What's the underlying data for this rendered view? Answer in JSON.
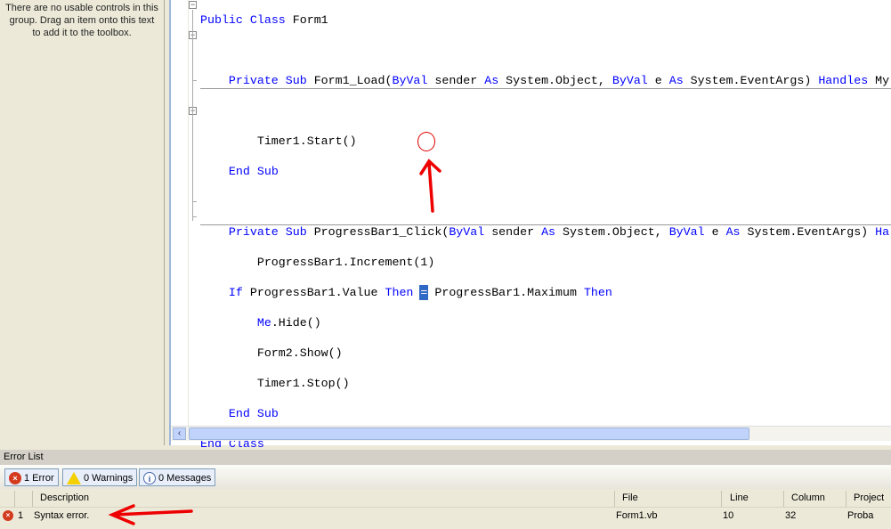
{
  "toolbox": {
    "empty_text": "There are no usable controls in this group. Drag an item onto this text to add it to the toolbox."
  },
  "code": {
    "l1": [
      "Public",
      " ",
      "Class",
      " Form1"
    ],
    "l3": {
      "a": "Private",
      "b": "Sub",
      "c": " Form1_Load(",
      "d": "ByVal",
      "e": " sender ",
      "f": "As",
      "g": " System.Object, ",
      "h": "ByVal",
      "i": " e ",
      "j": "As",
      "k": " System.EventArgs) ",
      "l": "Handles",
      "m": " My"
    },
    "l5": "Timer1.Start()",
    "l6": [
      "End",
      "Sub"
    ],
    "l8": {
      "a": "Private",
      "b": "Sub",
      "c": " ProgressBar1_Click(",
      "d": "ByVal",
      "e": " sender ",
      "f": "As",
      "g": " System.Object, ",
      "h": "ByVal",
      "i": " e ",
      "j": "As",
      "k": " System.EventArgs) ",
      "l": "Ha"
    },
    "l9": "ProgressBar1.Increment(1)",
    "l10": {
      "a": "If",
      "b": " ProgressBar1.Value ",
      "c": "Then",
      "d": "=",
      "e": " ProgressBar1.Maximum ",
      "f": "Then"
    },
    "l11": {
      "a": "Me",
      ".b": ".Hide()"
    },
    "l11b": ".Hide()",
    "l12": "Form2.Show()",
    "l13": "Timer1.Stop()",
    "l14": [
      "End",
      "Sub"
    ],
    "l15": [
      "End",
      "Class"
    ]
  },
  "error_list": {
    "title": "Error List",
    "errors_btn": "1 Error",
    "warnings_btn": "0 Warnings",
    "messages_btn": "0 Messages",
    "columns": [
      "Description",
      "File",
      "Line",
      "Column",
      "Project"
    ],
    "rows": [
      {
        "num": "1",
        "description": "Syntax error.",
        "file": "Form1.vb",
        "line": "10",
        "column": "32",
        "project": "Proba"
      }
    ]
  },
  "colors": {
    "keyword": "#0000ff",
    "annotation": "#ff0000"
  }
}
